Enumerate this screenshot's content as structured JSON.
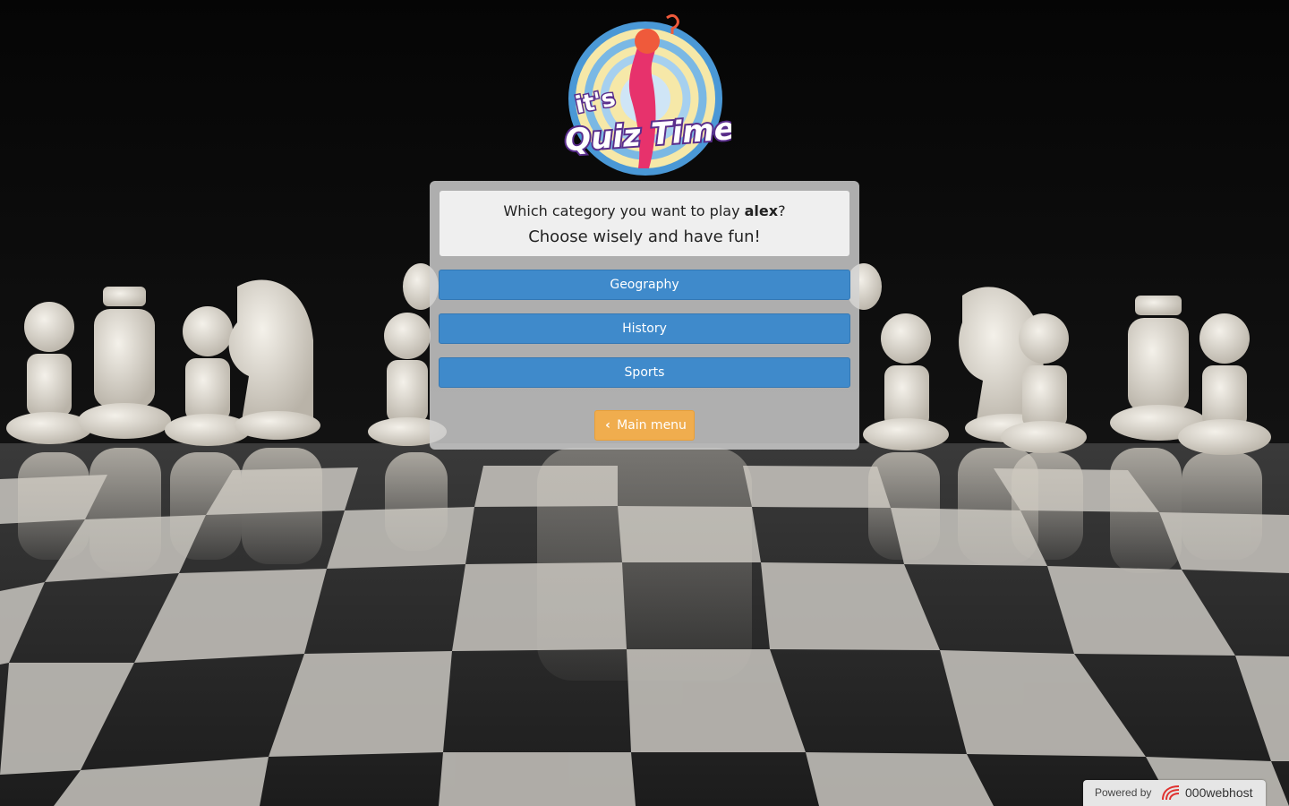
{
  "logo": {
    "line1": "it's",
    "line2": "Quiz Time"
  },
  "prompt": {
    "before": "Which category you want to play ",
    "player": "alex",
    "after": "?",
    "subtitle": "Choose wisely and have fun!"
  },
  "categories": [
    {
      "label": "Geography"
    },
    {
      "label": "History"
    },
    {
      "label": "Sports"
    }
  ],
  "main_menu": {
    "label": "Main menu"
  },
  "footer": {
    "powered_by": "Powered by",
    "brand": "000webhost"
  },
  "colors": {
    "primary_button": "#3f8acb",
    "warning_button": "#f0ad4e"
  }
}
